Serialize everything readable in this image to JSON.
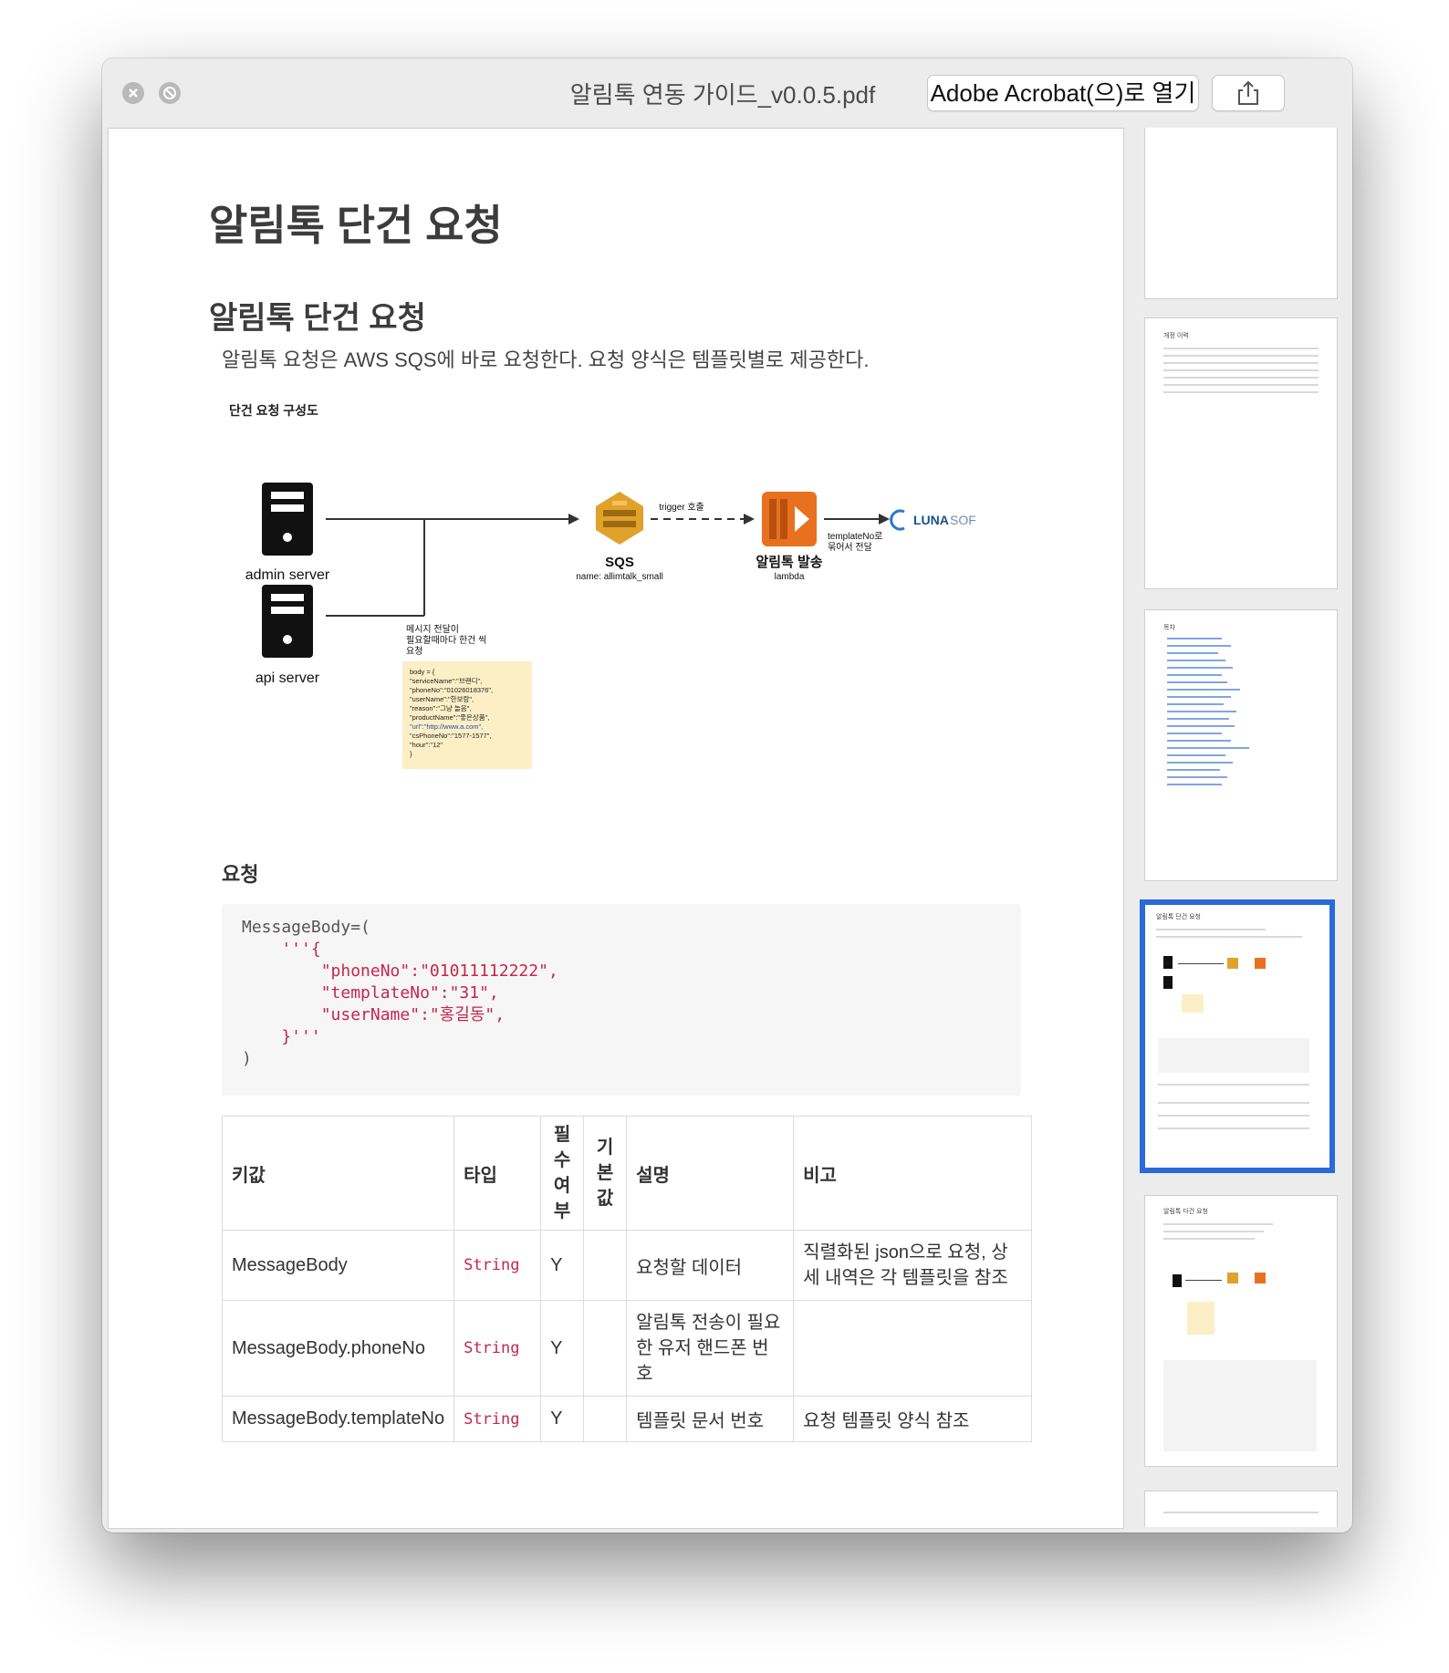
{
  "window": {
    "title": "알림톡 연동 가이드_v0.0.5.pdf",
    "open_button": "Adobe Acrobat(으)로 열기",
    "share_icon": "share-icon",
    "close_icon": "close-icon",
    "minimize_icon": "minimize-icon"
  },
  "page": {
    "title": "알림톡 단건 요청",
    "section_title": "알림톡 단건 요청",
    "intro": "알림톡 요청은 AWS SQS에 바로 요청한다. 요청 양식은 템플릿별로 제공한다.",
    "diagram": {
      "caption": "단건 요청 구성도",
      "admin_server": "admin server",
      "api_server": "api server",
      "sqs_label": "SQS",
      "sqs_name": "name: allimtalk_small",
      "trigger_label": "trigger 호출",
      "lambda_label": "알림톡 발송",
      "lambda_sub": "lambda",
      "template_note_1": "templateNo로",
      "template_note_2": "묶어서 전달",
      "lunasoft_a": "LUNA",
      "lunasoft_b": "SOFT",
      "msg_note_1": "메시지 전달이",
      "msg_note_2": "필요할때마다 한건 씩",
      "msg_note_3": "요청",
      "body_lines": [
        "body = {",
        "  \"serviceName\":\"브랜디\",",
        "  \"phoneNo\":\"01026018376\",",
        "  \"userName\":\"한보람\",",
        "  \"reason\":\"그냥 놀음\",",
        "  \"productName\":\"좋은상품\",",
        "  \"url\":\"http://www.a.com\",",
        "  \"csPhoneNo\":\"1577-1577\",",
        "  \"hour\":\"12\"",
        "}"
      ]
    },
    "request_heading": "요청",
    "code": {
      "l1": "MessageBody=(",
      "l2": "    '''{",
      "l3": "        \"phoneNo\":\"01011112222\",",
      "l4": "        \"templateNo\":\"31\",",
      "l5": "        \"userName\":\"홍길동\",",
      "l6": "    }'''",
      "l7": ")"
    },
    "table": {
      "headers": {
        "key": "키값",
        "type": "타입",
        "required": "필수여부",
        "default": "기본값",
        "desc": "설명",
        "note": "비고"
      },
      "rows": [
        {
          "key": "MessageBody",
          "type": "String",
          "required": "Y",
          "default": "",
          "desc": "요청할 데이터",
          "note": "직렬화된 json으로 요청, 상세 내역은 각 템플릿을 참조"
        },
        {
          "key": "MessageBody.phoneNo",
          "type": "String",
          "required": "Y",
          "default": "",
          "desc": "알림톡 전송이 필요한 유저 핸드폰 번호",
          "note": ""
        },
        {
          "key": "MessageBody.templateNo",
          "type": "String",
          "required": "Y",
          "default": "",
          "desc": "템플릿 문서 번호",
          "note": "요청 템플릿 양식 참조"
        }
      ]
    }
  },
  "thumbnails": {
    "t2_title": "개정 이력",
    "t3_title": "목차",
    "t4_title": "알림톡 단건 요청",
    "t5_title": "알림톡 다건 요청"
  }
}
